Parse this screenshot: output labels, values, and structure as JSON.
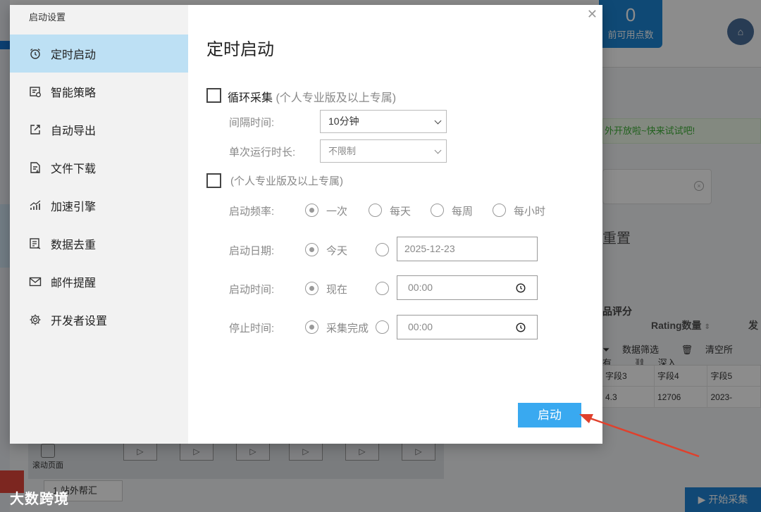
{
  "background": {
    "points": {
      "value": "0",
      "label": "前可用点数"
    },
    "notice": "外开放啦~快来试试吧!",
    "reset_label": "重置",
    "rating_header": "品评分",
    "rating_column": "Rating数量",
    "rating_column2": "发",
    "toolbar": {
      "filter": "数据筛选",
      "clear": "清空所有",
      "deep": "深入"
    },
    "table": {
      "headers": [
        "字段3",
        "字段4",
        "字段5"
      ],
      "row": [
        "4.3",
        "12706",
        "2023-"
      ]
    },
    "scroll_page_label": "滚动页面",
    "bottom_tab_label": "1 站外帮汇",
    "watermark": "大数跨境",
    "start_collect_label": "开始采集"
  },
  "modal": {
    "window_title": "启动设置",
    "menu": [
      {
        "label": "定时启动",
        "icon": "alarm-clock-icon",
        "active": true
      },
      {
        "label": "智能策略",
        "icon": "strategy-icon",
        "active": false
      },
      {
        "label": "自动导出",
        "icon": "export-icon",
        "active": false
      },
      {
        "label": "文件下载",
        "icon": "file-download-icon",
        "active": false
      },
      {
        "label": "加速引擎",
        "icon": "speed-chart-icon",
        "active": false
      },
      {
        "label": "数据去重",
        "icon": "dedupe-icon",
        "active": false
      },
      {
        "label": "邮件提醒",
        "icon": "mail-icon",
        "active": false
      },
      {
        "label": "开发者设置",
        "icon": "gear-icon",
        "active": false
      }
    ],
    "title": "定时启动",
    "loop": {
      "checked": false,
      "label": "循环采集",
      "note": "(个人专业版及以上专属)",
      "interval_label": "间隔时间:",
      "interval_value": "10分钟",
      "duration_label": "单次运行时长:",
      "duration_value": "不限制"
    },
    "schedule": {
      "checked": false,
      "note": "(个人专业版及以上专属)",
      "frequency_label": "启动频率:",
      "frequency_options": [
        "一次",
        "每天",
        "每周",
        "每小时"
      ],
      "frequency_selected": "一次",
      "date_label": "启动日期:",
      "date_today": "今天",
      "date_value": "2025-12-23",
      "time_label": "启动时间:",
      "time_now": "现在",
      "time_value": "00:00",
      "stop_label": "停止时间:",
      "stop_done": "采集完成",
      "stop_value": "00:00"
    },
    "start_button": "启动"
  },
  "colors": {
    "accent": "#39a9f0",
    "menu_active": "#bde0f4",
    "annotation_arrow": "#e0402c"
  }
}
